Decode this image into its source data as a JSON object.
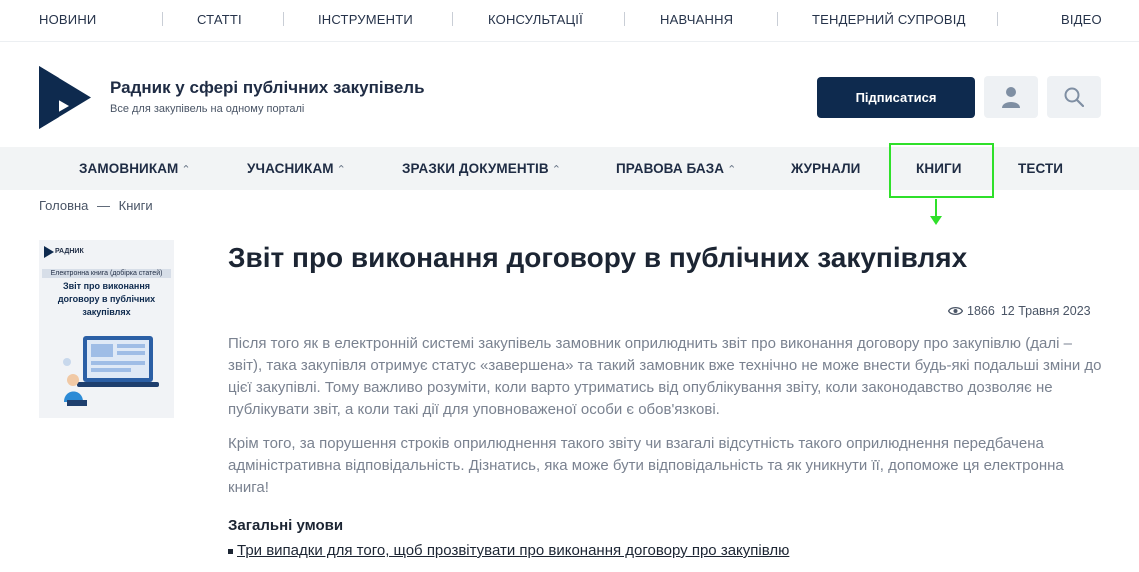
{
  "top_nav": [
    "НОВИНИ",
    "СТАТТІ",
    "ІНСТРУМЕНТИ",
    "КОНСУЛЬТАЦІЇ",
    "НАВЧАННЯ",
    "ТЕНДЕРНИЙ СУПРОВІД",
    "ВІДЕО"
  ],
  "header": {
    "title": "Радник у сфері публічних закупівель",
    "subtitle": "Все для закупівель на одному порталі",
    "subscribe_label": "Підписатися",
    "user_icon": "user-icon",
    "search_icon": "search-icon"
  },
  "main_menu": [
    {
      "label": "ЗАМОВНИКАМ",
      "chevron": "⌃"
    },
    {
      "label": "УЧАСНИКАМ",
      "chevron": "⌃"
    },
    {
      "label": "ЗРАЗКИ ДОКУМЕНТІВ",
      "chevron": "⌃"
    },
    {
      "label": "ПРАВОВА БАЗА",
      "chevron": "⌃"
    },
    {
      "label": "ЖУРНАЛИ"
    },
    {
      "label": "КНИГИ"
    },
    {
      "label": "ТЕСТИ"
    }
  ],
  "breadcrumb": {
    "home": "Головна",
    "separator": "—",
    "current": "Книги"
  },
  "cover": {
    "brand": "РАДНИК",
    "band": "Електронна книга (добірка статей)",
    "title": "Звіт про виконання договору в публічних закупівлях"
  },
  "article": {
    "title": "Звіт про виконання договору в публічних закупівлях",
    "views": "1866",
    "date": "12 Травня 2023",
    "p1": "Після того як в електронній системі закупівель замовник оприлюднить звіт про виконання договору про закупівлю (далі – звіт), така закупівля отримує статус «завершена» та такий замовник вже технічно не може внести будь-які подальші зміни до цієї закупівлі. Тому важливо розуміти, коли варто утриматись від опублікування звіту, коли законодавство дозволяє не публікувати звіт, а коли такі дії для уповноваженої особи є обов'язкові.",
    "p2": "Крім того, за порушення строків оприлюднення такого звіту чи взагалі відсутність такого оприлюднення передбачена адміністративна відповідальність. Дізнатись, яка може бути відповідальність та як уникнути її, допоможе ця електронна книга!",
    "section_title": "Загальні умови",
    "link1": "Три випадки для того, щоб прозвітувати про виконання договору про закупівлю"
  },
  "colors": {
    "accent_navy": "#0e2a4e",
    "highlight": "#2fe02a",
    "menu_bg": "#f2f4f5"
  }
}
